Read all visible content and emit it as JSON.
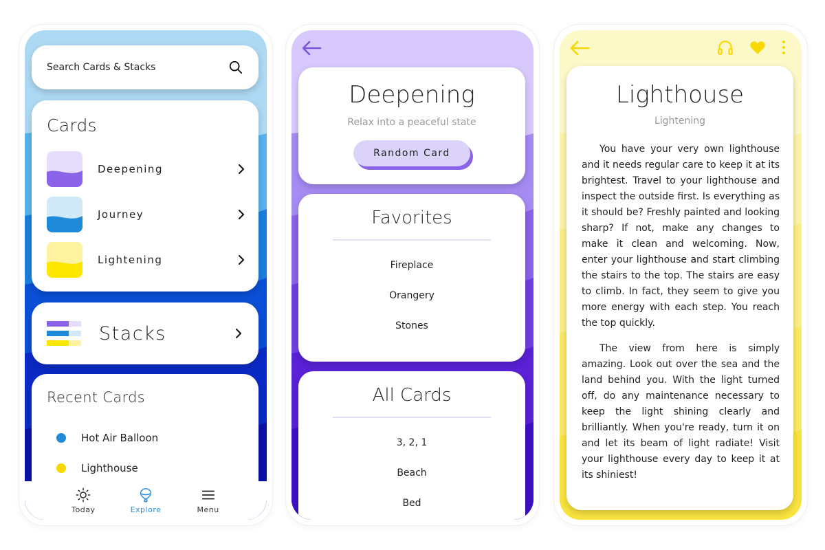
{
  "colors": {
    "deepening": "#8b63e8",
    "journey": "#1f8ad8",
    "lightening": "#fde700",
    "accent": "#2a8fe0"
  },
  "explore": {
    "search": {
      "placeholder": "Search Cards & Stacks",
      "icon": "search-icon"
    },
    "cards": {
      "title": "Cards",
      "items": [
        {
          "label": "Deepening"
        },
        {
          "label": "Journey"
        },
        {
          "label": "Lightening"
        }
      ]
    },
    "stacks": {
      "label": "Stacks"
    },
    "recent": {
      "title": "Recent Cards",
      "items": [
        {
          "label": "Hot Air Balloon",
          "color": "#1f8ad8"
        },
        {
          "label": "Lighthouse",
          "color": "#f7d800"
        }
      ]
    },
    "nav": [
      {
        "label": "Today",
        "icon": "sun-icon"
      },
      {
        "label": "Explore",
        "icon": "balloon-icon",
        "active": true
      },
      {
        "label": "Menu",
        "icon": "menu-icon"
      }
    ]
  },
  "deck": {
    "title": "Deepening",
    "subtitle": "Relax into a peaceful state",
    "random_button": "Random Card",
    "favorites": {
      "title": "Favorites",
      "items": [
        "Fireplace",
        "Orangery",
        "Stones"
      ]
    },
    "all_cards": {
      "title": "All Cards",
      "items": [
        "3, 2, 1",
        "Beach",
        "Bed"
      ]
    }
  },
  "reader": {
    "title": "Lighthouse",
    "subtitle": "Lightening",
    "paragraphs": [
      "You have your very own lighthouse and it needs regular care to keep it at its brightest. Travel to your lighthouse and inspect the outside first. Is everything as it should be? Freshly painted and looking sharp? If not, make any changes to make it clean and welcoming. Now, enter your lighthouse and start climbing the stairs to the top. The stairs are easy to climb. In fact, they seem to give you more energy with each step. You reach the top quickly.",
      "The view from here is simply amazing. Look out over the sea and the land behind you. With the light turned off, do any maintenance necessary to keep the light shining clearly and brilliantly. When you're ready, turn it on and let its beam of light radiate! Visit your lighthouse every day to keep it at its shiniest!"
    ]
  }
}
